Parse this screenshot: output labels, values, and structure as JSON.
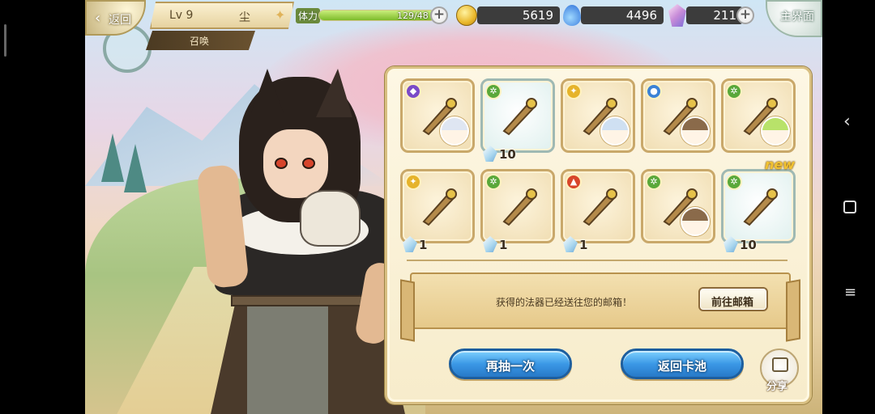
{
  "top_bar": {
    "back_label": "返回",
    "level": "Lv 9",
    "player_name": "尘",
    "summon_tab": "召唤",
    "stamina_label": "体力",
    "stamina_value": "129/48",
    "stamina_fraction": 1.0,
    "gold": "5619",
    "water": "4496",
    "gems": "211",
    "home_label": "主界面"
  },
  "results": {
    "cards": [
      {
        "element": "arcane",
        "element_color": "#7b4bc8",
        "item": "dark-wing-icon",
        "has_portrait": true,
        "qty": "",
        "new": false,
        "special": false
      },
      {
        "element": "wind",
        "element_color": "#5aa83a",
        "item": "feather-earring-icon",
        "has_portrait": false,
        "qty": "10",
        "new": false,
        "special": true
      },
      {
        "element": "light",
        "element_color": "#e6b32a",
        "item": "dagger-icon",
        "has_portrait": true,
        "qty": "",
        "new": false,
        "special": false
      },
      {
        "element": "water",
        "element_color": "#3b82d6",
        "item": "ring-rope-icon",
        "has_portrait": true,
        "qty": "",
        "new": false,
        "special": false
      },
      {
        "element": "wind",
        "element_color": "#5aa83a",
        "item": "trident-staff-icon",
        "has_portrait": true,
        "qty": "",
        "new": false,
        "special": false
      },
      {
        "element": "light",
        "element_color": "#e6b32a",
        "item": "gold-bar-icon",
        "has_portrait": false,
        "qty": "1",
        "new": false,
        "special": false
      },
      {
        "element": "wind",
        "element_color": "#5aa83a",
        "item": "crossbow-icon",
        "has_portrait": false,
        "qty": "1",
        "new": false,
        "special": false
      },
      {
        "element": "fire",
        "element_color": "#d8462a",
        "item": "wooden-sword-icon",
        "has_portrait": false,
        "qty": "1",
        "new": false,
        "special": false
      },
      {
        "element": "wind",
        "element_color": "#5aa83a",
        "item": "cloth-bag-icon",
        "has_portrait": true,
        "qty": "",
        "new": false,
        "special": false
      },
      {
        "element": "wind",
        "element_color": "#5aa83a",
        "item": "leaf-bracelet-icon",
        "has_portrait": false,
        "qty": "10",
        "new": true,
        "special": true
      }
    ],
    "new_label": "new",
    "mail_message": "获得的法器已经送往您的邮箱！",
    "mail_button": "前往邮箱",
    "draw_again": "再抽一次",
    "back_to_pool": "返回卡池",
    "share": "分享"
  },
  "colors": {
    "button_blue": "#3b98e6",
    "panel_bg": "#fdf7e4",
    "gold_border": "#c9a86a"
  }
}
